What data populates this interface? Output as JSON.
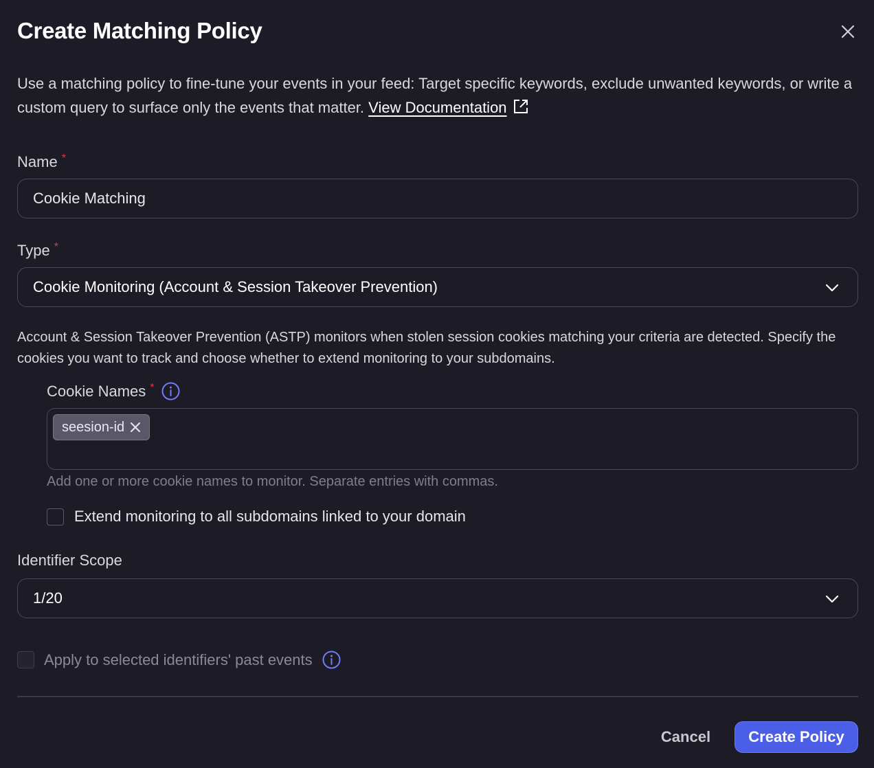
{
  "dialog": {
    "title": "Create Matching Policy",
    "intro_text": "Use a matching policy to fine-tune your events in your feed: Target specific keywords, exclude unwanted keywords, or write a custom query to surface only the events that matter.",
    "doc_link": "View Documentation"
  },
  "form": {
    "name_label": "Name",
    "name_value": "Cookie Matching",
    "type_label": "Type",
    "type_value": "Cookie Monitoring (Account & Session Takeover Prevention)",
    "astp_description": "Account & Session Takeover Prevention (ASTP) monitors when stolen session cookies matching your criteria are detected. Specify the cookies you want to track and choose whether to extend monitoring to your subdomains.",
    "cookie_names_label": "Cookie Names",
    "cookie_chips": [
      "seesion-id"
    ],
    "cookie_hint": "Add one or more cookie names to monitor. Separate entries with commas.",
    "subdomains_label": "Extend monitoring to all subdomains linked to your domain",
    "subdomains_checked": false,
    "identifier_scope_label": "Identifier Scope",
    "identifier_scope_value": "1/20",
    "past_events_label": "Apply to selected identifiers' past events",
    "past_events_checked": false,
    "required_marker": "*"
  },
  "footer": {
    "cancel_label": "Cancel",
    "create_label": "Create Policy"
  },
  "colors": {
    "background": "#1c1b26",
    "primary": "#4a5ee8",
    "required": "#e03a4e",
    "info": "#6f7ef5"
  },
  "icons": [
    "close-icon",
    "external-link-icon",
    "chevron-down-icon",
    "info-icon",
    "chip-remove-icon"
  ]
}
